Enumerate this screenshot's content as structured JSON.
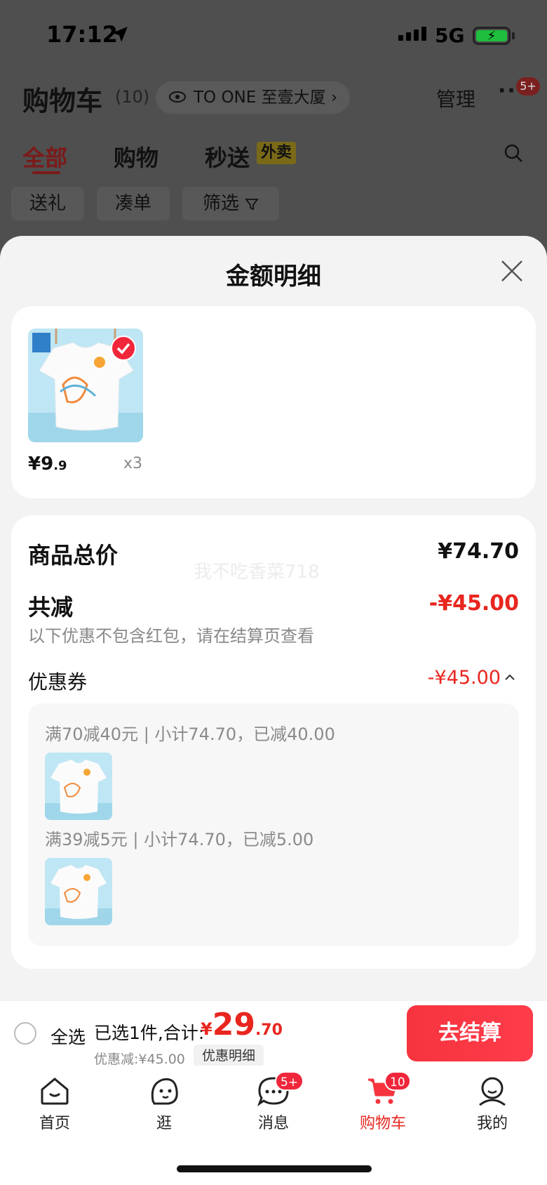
{
  "status_bar": {
    "time": "17:12",
    "network": "5G"
  },
  "header": {
    "title": "购物车",
    "count": "(10)",
    "address": "TO ONE 至壹大厦",
    "address_chevron": "›",
    "manage": "管理",
    "more": "···",
    "more_badge": "5+"
  },
  "tabs": [
    {
      "label": "全部"
    },
    {
      "label": "购物"
    },
    {
      "label": "秒送"
    }
  ],
  "waimai_badge": "外卖",
  "chips": [
    {
      "label": "送礼"
    },
    {
      "label": "凑单"
    },
    {
      "label": "筛选"
    }
  ],
  "sheet": {
    "title": "金额明细",
    "product": {
      "price_int": "¥9",
      "price_dec": ".9",
      "qty": "x3"
    },
    "total_label": "商品总价",
    "total_value": "¥74.70",
    "watermark": "我不吃香菜718",
    "reduce_label": "共减",
    "reduce_value": "-¥45.00",
    "note": "以下优惠不包含红包，请在结算页查看",
    "coupon_label": "优惠券",
    "coupon_value": "-¥45.00",
    "coupon_rules": [
      "满70减40元 | 小计74.70，已减40.00",
      "满39减5元 | 小计74.70，已减5.00"
    ]
  },
  "checkout": {
    "select_all": "全选",
    "selected_text": "已选1件,合计:",
    "currency": "¥",
    "total_int": "29",
    "total_dec": ".70",
    "discount_text": "优惠减:¥45.00",
    "detail_chip": "优惠明细",
    "button": "去结算"
  },
  "tabbar": [
    {
      "label": "首页"
    },
    {
      "label": "逛"
    },
    {
      "label": "消息",
      "badge": "5+"
    },
    {
      "label": "购物车",
      "badge": "10"
    },
    {
      "label": "我的"
    }
  ],
  "colors": {
    "accent_red": "#e8261f",
    "button_red": "#f5343e",
    "sheet_bg": "#f3f3f3"
  }
}
